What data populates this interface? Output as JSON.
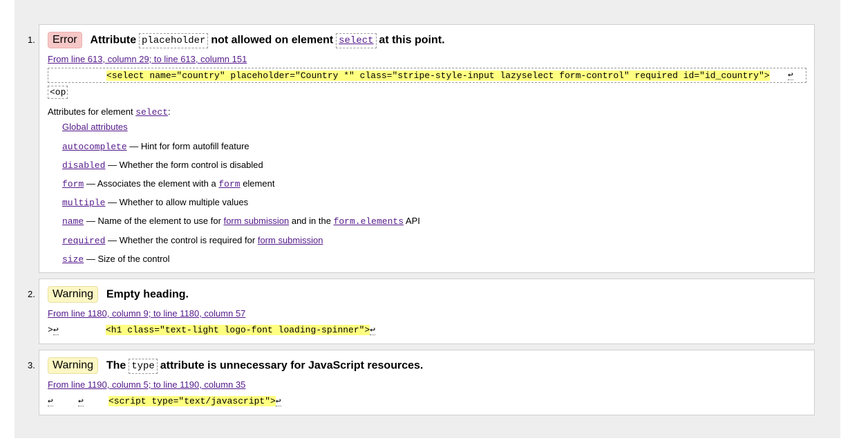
{
  "messages": [
    {
      "number": "1.",
      "type": "Error",
      "title_before": "Attribute",
      "title_code1": "placeholder",
      "title_mid": "not allowed on element",
      "title_code2": "select",
      "title_after": "at this point.",
      "location": "From line 613, column 29; to line 613, column 151",
      "extract_code": "<select name=\"country\" placeholder=\"Country *\" class=\"stripe-style-input lazyselect form-control\" required id=\"id_country\">",
      "return_glyph": "↩",
      "extract_tail": "<op",
      "attrs_intro_before": "Attributes for element",
      "attrs_intro_code": "select",
      "attrs_intro_after": ":",
      "global_attrs": "Global attributes",
      "attributes": [
        {
          "name": "autocomplete",
          "desc": "— Hint for form autofill feature"
        },
        {
          "name": "disabled",
          "desc": "— Whether the form control is disabled"
        },
        {
          "name": "form",
          "desc_before": "— Associates the element with a",
          "desc_code": "form",
          "desc_after": "element"
        },
        {
          "name": "multiple",
          "desc": "— Whether to allow multiple values"
        },
        {
          "name": "name",
          "desc_before": "— Name of the element to use for",
          "desc_link": "form submission",
          "desc_mid": "and in the",
          "desc_code": "form.elements",
          "desc_after": "API"
        },
        {
          "name": "required",
          "desc_before": "— Whether the control is required for",
          "desc_link": "form submission"
        },
        {
          "name": "size",
          "desc": "— Size of the control"
        }
      ]
    },
    {
      "number": "2.",
      "type": "Warning",
      "title": "Empty heading.",
      "location": "From line 1180, column 9; to line 1180, column 57",
      "extract_prefix": ">",
      "return_glyph": "↩",
      "extract_code": "<h1 class=\"text-light logo-font loading-spinner\">"
    },
    {
      "number": "3.",
      "type": "Warning",
      "title_before": "The",
      "title_code": "type",
      "title_after": "attribute is unnecessary for JavaScript resources.",
      "location": "From line 1190, column 5; to line 1190, column 35",
      "return_glyph": "↩",
      "extract_code": "<script type=\"text/javascript\">"
    }
  ]
}
